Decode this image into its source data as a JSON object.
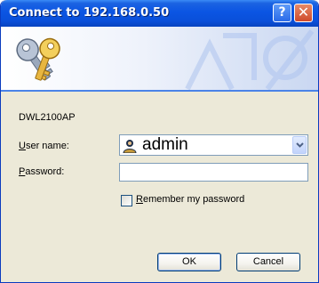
{
  "window": {
    "title": "Connect to 192.168.0.50",
    "help_label": "?",
    "close_label": "✕"
  },
  "banner": {
    "icon": "keys-icon"
  },
  "form": {
    "server_name": "DWL2100AP",
    "username_label_hotkey": "U",
    "username_label_rest": "ser name:",
    "username_value": "admin",
    "username_icon": "user-icon",
    "password_label_hotkey": "P",
    "password_label_rest": "assword:",
    "password_value": "",
    "remember_label_hotkey": "R",
    "remember_label_rest": "emember my password",
    "remember_checked": false
  },
  "buttons": {
    "ok_label": "OK",
    "cancel_label": "Cancel"
  },
  "colors": {
    "title_bar": "#0a4fd9",
    "dialog_bg": "#ece9d8",
    "banner_line": "#4a83e8",
    "close_button": "#cf4a2b"
  }
}
